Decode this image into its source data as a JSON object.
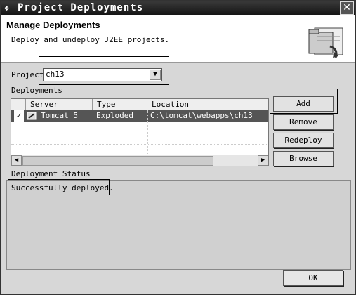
{
  "window": {
    "title": "Project Deployments",
    "close_glyph": "✕"
  },
  "header": {
    "title": "Manage Deployments",
    "subtitle": "Deploy and undeploy J2EE projects."
  },
  "project": {
    "label": "Project",
    "value": "ch13"
  },
  "deployments": {
    "label": "Deployments",
    "columns": [
      "Server",
      "Type",
      "Location"
    ],
    "rows": [
      {
        "checked": true,
        "check_glyph": "✓",
        "server": "Tomcat 5",
        "type": "Exploded",
        "location": "C:\\tomcat\\webapps\\ch13"
      }
    ]
  },
  "buttons": {
    "add": "Add",
    "remove": "Remove",
    "redeploy": "Redeploy",
    "browse": "Browse",
    "ok": "OK"
  },
  "status": {
    "label": "Deployment Status",
    "text": "Successfully deployed."
  },
  "icons": {
    "window": "window-icon",
    "header": "deploy-wizard-icon",
    "server": "server-icon",
    "dropdown": "chevron-down-icon",
    "scroll_left": "arrow-left-icon",
    "scroll_right": "arrow-right-icon"
  }
}
